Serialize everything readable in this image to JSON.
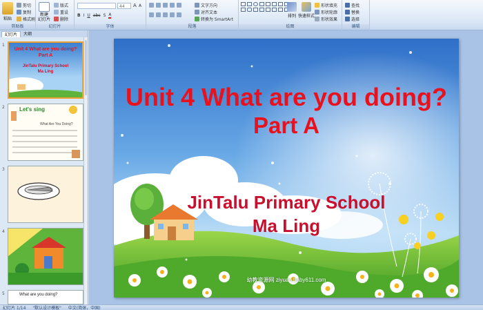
{
  "ribbon": {
    "clipboard": {
      "paste": "粘贴",
      "cut": "剪切",
      "copy": "复制",
      "format_painter": "格式刷",
      "label": "剪贴板"
    },
    "slides": {
      "new_slide": "新建\n幻灯片",
      "layout": "版式",
      "reset": "重设",
      "delete": "删除",
      "label": "幻灯片"
    },
    "font": {
      "size": "44",
      "label": "字体"
    },
    "paragraph": {
      "text_direction": "文字方向",
      "align_text": "对齐文本",
      "smartart": "转换为 SmartArt",
      "label": "段落"
    },
    "drawing": {
      "arrange": "排列",
      "quick_styles": "快速样式",
      "shape_fill": "形状填充",
      "shape_outline": "形状轮廓",
      "shape_effects": "形状效果",
      "label": "绘图"
    },
    "editing": {
      "find": "查找",
      "replace": "替换",
      "select": "选择",
      "label": "编辑"
    }
  },
  "pane": {
    "tabs": [
      "幻灯片",
      "大纲"
    ],
    "slides": [
      {
        "num": "1",
        "title1": "Unit 4  What are you doing?",
        "title2": "Part A",
        "school": "JinTalu Primary School",
        "teacher": "Ma Ling"
      },
      {
        "num": "2",
        "heading": "Let's sing",
        "subtitle": "What Are You Doing?"
      },
      {
        "num": "3"
      },
      {
        "num": "4"
      },
      {
        "num": "5",
        "question": "What are you doing?"
      }
    ]
  },
  "slide": {
    "title_line1": "Unit 4  What are you doing?",
    "title_line2": "Part A",
    "school": "JinTalu Primary School",
    "teacher": "Ma Ling",
    "watermark": "幼教资源网 ziyuan.baby611.com",
    "title_color": "#e8121e",
    "body_color": "#c8102e"
  },
  "status": {
    "slide_indicator": "幻灯片 1/14",
    "theme": "\"默认设计模板\"",
    "language": "中文(简体，中国)"
  }
}
